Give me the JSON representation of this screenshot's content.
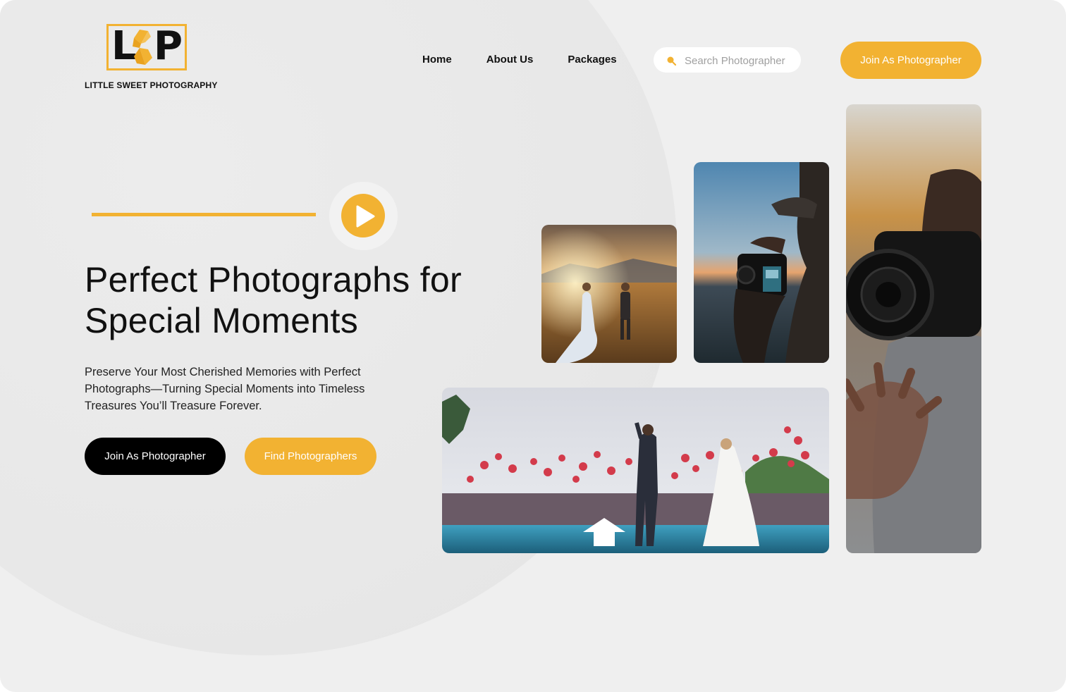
{
  "brand": {
    "letters": [
      "L",
      "P"
    ],
    "name": "LITTLE SWEET PHOTOGRAPHY",
    "accent_color": "#f2b232"
  },
  "nav": {
    "items": [
      "Home",
      "About Us",
      "Packages"
    ]
  },
  "search": {
    "placeholder": "Search Photographer",
    "icon": "search-icon"
  },
  "header": {
    "join_label": "Join As Photographer"
  },
  "hero": {
    "title_line1": "Perfect Photographs for",
    "title_line2": "Special Moments",
    "subtitle": "Preserve Your Most Cherished Memories with Perfect Photographs—Turning Special Moments into Timeless Treasures You’ll Treasure Forever.",
    "play_icon": "play-icon",
    "primary_button": "Join As Photographer",
    "secondary_button": "Find Photographers"
  },
  "gallery": {
    "images": [
      {
        "name": "couple-sunset-photo"
      },
      {
        "name": "photographer-sunset-photo"
      },
      {
        "name": "wedding-balloons-photo"
      },
      {
        "name": "photographer-closeup-photo"
      }
    ]
  }
}
